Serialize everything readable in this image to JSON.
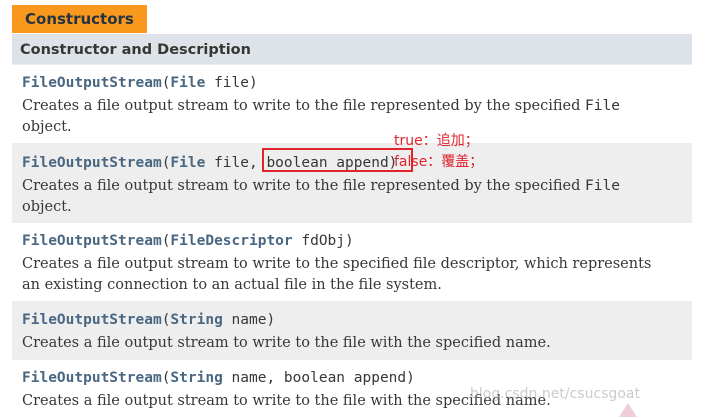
{
  "tab_label": "Constructors",
  "table_header": "Constructor and Description",
  "rows": [
    {
      "method": "FileOutputStream",
      "open_paren": "(",
      "type1": "File",
      "rest": " file)",
      "desc_line1": "Creates a file output stream to write to the file represented by the specified ",
      "desc_mono": "File",
      "desc_line2": "object."
    },
    {
      "method": "FileOutputStream",
      "open_paren": "(",
      "type1": "File",
      "rest": " file, boolean append)",
      "desc_line1": "Creates a file output stream to write to the file represented by the specified ",
      "desc_mono": "File",
      "desc_line2": "object."
    },
    {
      "method": "FileOutputStream",
      "open_paren": "(",
      "type1": "FileDescriptor",
      "rest": " fdObj)",
      "desc_line1": "Creates a file output stream to write to the specified file descriptor, which represents",
      "desc_line2": "an existing connection to an actual file in the file system."
    },
    {
      "method": "FileOutputStream",
      "open_paren": "(",
      "type1": "String",
      "rest": " name)",
      "desc_line1": "Creates a file output stream to write to the file with the specified name."
    },
    {
      "method": "FileOutputStream",
      "open_paren": "(",
      "type1": "String",
      "rest": " name, boolean append)",
      "desc_line1": "Creates a file output stream to write to the file with the specified name."
    }
  ],
  "annotation": {
    "true_note": "true：追加；",
    "false_note": "false：覆盖；"
  },
  "watermark": "blog.csdn.net/csucsgoat",
  "colors": {
    "tab_bg": "#f8981d",
    "header_bg": "#dee3e9",
    "link": "#4a6782",
    "highlight": "#e0242b"
  }
}
